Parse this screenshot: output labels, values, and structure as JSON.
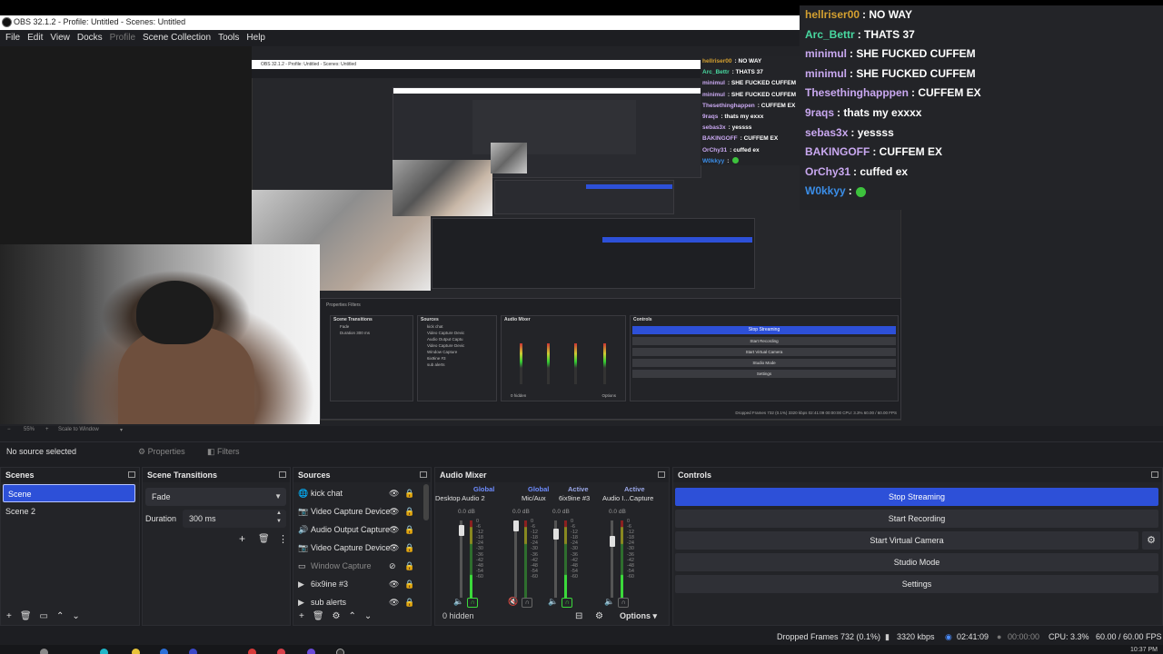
{
  "window": {
    "title": "OBS 32.1.2 - Profile: Untitled - Scenes: Untitled",
    "min": "—",
    "max": "☐",
    "close": "✕"
  },
  "menu": [
    "File",
    "Edit",
    "View",
    "Docks",
    "Profile",
    "Scene Collection",
    "Tools",
    "Help"
  ],
  "chat": [
    {
      "user": "hellriser00",
      "msg": ": NO WAY",
      "color": "#d4a030"
    },
    {
      "user": "Arc_Bettr",
      "msg": ": THATS 37",
      "color": "#48d8a0"
    },
    {
      "user": "minimul",
      "msg": ": SHE FUCKED CUFFEM",
      "color": "#c9a8f0"
    },
    {
      "user": "minimul",
      "msg": ": SHE FUCKED CUFFEM",
      "color": "#c9a8f0"
    },
    {
      "user": "Thesethinghapppen",
      "msg": ": CUFFEM EX",
      "color": "#c9a8f0"
    },
    {
      "user": "9raqs",
      "msg": ": thats my exxxx",
      "color": "#c9a8f0"
    },
    {
      "user": "sebas3x",
      "msg": ": yessss",
      "color": "#c9a8f0"
    },
    {
      "user": "BAKINGOFF",
      "msg": ": CUFFEM EX",
      "color": "#c9a8f0"
    },
    {
      "user": "OrChy31",
      "msg": ": cuffed ex",
      "color": "#c9a8f0"
    },
    {
      "user": "W0kkyy",
      "msg": ":",
      "color": "#3b8ee8",
      "emote": true
    }
  ],
  "chat_small": [
    {
      "user": "hellriser00",
      "msg": ": NO WAY",
      "color": "#d4a030"
    },
    {
      "user": "Arc_Bettr",
      "msg": ": THATS 37",
      "color": "#48d8a0"
    },
    {
      "user": "minimul",
      "msg": ": SHE FUCKED CUFFEM",
      "color": "#c9a8f0"
    },
    {
      "user": "minimul",
      "msg": ": SHE FUCKED CUFFEM",
      "color": "#c9a8f0"
    },
    {
      "user": "Thesethinghappen",
      "msg": ": CUFFEM EX",
      "color": "#c9a8f0"
    },
    {
      "user": "9raqs",
      "msg": ": thats my exxx",
      "color": "#c9a8f0"
    },
    {
      "user": "sebas3x",
      "msg": ": yessss",
      "color": "#c9a8f0"
    },
    {
      "user": "BAKINGOFF",
      "msg": ": CUFFEM EX",
      "color": "#c9a8f0"
    },
    {
      "user": "OrChy31",
      "msg": ": cuffed ex",
      "color": "#c9a8f0"
    },
    {
      "user": "W0kkyy",
      "msg": ":",
      "color": "#3b8ee8",
      "emote": true
    }
  ],
  "zoom": {
    "minus": "−",
    "value": "55%",
    "plus": "+",
    "scale": "Scale to Window",
    "caret": "▾"
  },
  "source_toolbar": {
    "no_source": "No source selected",
    "properties": "⚙ Properties",
    "filters": "◧ Filters"
  },
  "scenes": {
    "title": "Scenes",
    "items": [
      "Scene",
      "Scene 2"
    ],
    "selected_index": 0,
    "toolbar": [
      "+",
      "🗑",
      "▭",
      "⌃",
      "⌄"
    ]
  },
  "transitions": {
    "title": "Scene Transitions",
    "selected": "Fade",
    "duration_label": "Duration",
    "duration_value": "300 ms",
    "add": "+",
    "remove": "🗑",
    "more": "⋮"
  },
  "sources": {
    "title": "Sources",
    "items": [
      {
        "name": "kick chat",
        "icon": "globe-icon",
        "glyph": "🌐",
        "visible": true
      },
      {
        "name": "Video Capture Device",
        "icon": "camera-icon",
        "glyph": "📷",
        "visible": true
      },
      {
        "name": "Audio Output Capture",
        "icon": "speaker-icon",
        "glyph": "🔊",
        "visible": true
      },
      {
        "name": "Video Capture Device",
        "icon": "camera-icon",
        "glyph": "📷",
        "visible": true
      },
      {
        "name": "Window Capture",
        "icon": "window-icon",
        "glyph": "▭",
        "visible": false
      },
      {
        "name": "6ix9ine #3",
        "icon": "play-icon",
        "glyph": "▶",
        "visible": true
      },
      {
        "name": "sub alerts",
        "icon": "play-icon",
        "glyph": "▶",
        "visible": true
      }
    ],
    "toolbar": [
      "+",
      "🗑",
      "⚙",
      "⌃",
      "⌄"
    ]
  },
  "mixer": {
    "title": "Audio Mixer",
    "channels": [
      {
        "tag": "Global",
        "name": "Desktop Audio 2",
        "db": "0.0 dB",
        "level": 0.06,
        "active_headphone": true
      },
      {
        "tag": "Global",
        "name": "Mic/Aux",
        "db": "0.0 dB",
        "level": 0,
        "muted": true
      },
      {
        "tag": "Active",
        "name": "6ix9ine #3",
        "db": "0.0 dB",
        "level": 0.1,
        "active_headphone": true
      },
      {
        "tag": "Active",
        "name": "Audio I...Capture",
        "db": "0.0 dB",
        "level": 0.2
      }
    ],
    "scale": [
      "0",
      "-6",
      "-12",
      "-18",
      "-24",
      "-30",
      "-36",
      "-42",
      "-48",
      "-54",
      "-60"
    ],
    "hidden": "0 hidden",
    "options": "Options"
  },
  "controls": {
    "title": "Controls",
    "buttons": [
      "Stop Streaming",
      "Start Recording",
      "Start Virtual Camera",
      "Studio Mode",
      "Settings"
    ]
  },
  "status": {
    "dropped": "Dropped Frames 732 (0.1%)",
    "bitrate": "3320 kbps",
    "live_time": "02:41:09",
    "rec_time": "00:00:00",
    "cpu": "CPU: 3.3%",
    "fps": "60.00 / 60.00 FPS",
    "clock": "10:37 PM"
  },
  "nested": {
    "title": "OBS 32.1.2 - Profile: Untitled - Scenes: Untitled",
    "tabs": "Properties    Filters",
    "docks": [
      "Scene Transitions",
      "Sources",
      "Audio Mixer",
      "Controls"
    ],
    "transition": "Fade",
    "duration": "Duration   300 ms",
    "sources": [
      "kick chat",
      "Video Capture Devic",
      "Audio Output Captu",
      "Video Capture Devic",
      "Window Capture",
      "6ix9ine #3",
      "sub alerts"
    ],
    "hidden": "0 hidden",
    "options": "Options",
    "controls": [
      "Stop Streaming",
      "Start Recording",
      "Start Virtual Camera",
      "Studio Mode",
      "Settings"
    ],
    "status": "Dropped Frames 732 (0.1%)   3320 kbps   02:41:09   00:00:00   CPU: 3.3%   60.00 / 60.00 FPS"
  }
}
